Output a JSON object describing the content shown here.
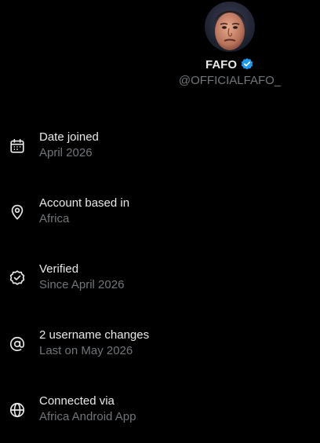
{
  "profile": {
    "display_name": "FAFO",
    "handle": "@OFFICIALFAFO_",
    "avatar_icon": "avatar",
    "verified_icon": "verified-badge-icon",
    "verified_color": "#1d9bf0"
  },
  "items": [
    {
      "icon": "calendar-icon",
      "title": "Date joined",
      "subtitle": "April 2026"
    },
    {
      "icon": "location-pin-icon",
      "title": "Account based in",
      "subtitle": "Africa"
    },
    {
      "icon": "verified-check-icon",
      "title": "Verified",
      "subtitle": "Since April 2026"
    },
    {
      "icon": "at-sign-icon",
      "title": "2 username changes",
      "subtitle": "Last on May 2026"
    },
    {
      "icon": "globe-icon",
      "title": "Connected via",
      "subtitle": "Africa Android App"
    }
  ],
  "colors": {
    "background": "#000000",
    "primary_text": "#e7e9ea",
    "secondary_text": "#71767b"
  }
}
